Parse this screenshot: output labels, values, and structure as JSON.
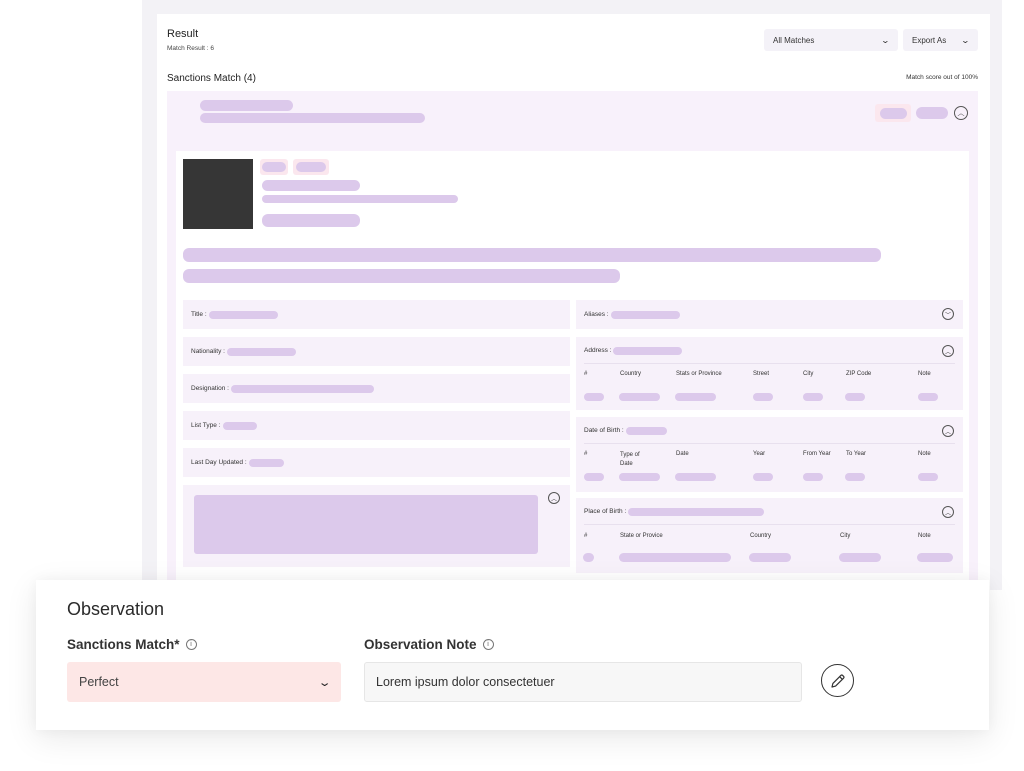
{
  "result": {
    "title": "Result",
    "subtitle": "Match Result : 6",
    "filter": {
      "label": "All Matches",
      "icon": "chevron-down-icon"
    },
    "export": {
      "label": "Export As",
      "icon": "chevron-down-icon"
    },
    "heading": "Sanctions Match (4)",
    "score_label": "Match score out of 100%"
  },
  "details": {
    "left_fields": {
      "title": "Title :",
      "nationality": "Nationality :",
      "designation": "Designation :",
      "list_type": "List Type :",
      "last_day_updated": "Last Day Updated :"
    },
    "aliases": {
      "label": "Aliases :",
      "icon": "chevron-down-circle-icon"
    },
    "address": {
      "label": "Address :",
      "icon": "chevron-up-circle-icon",
      "columns": [
        "#",
        "Country",
        "Stats or Province",
        "Street",
        "City",
        "ZIP Code",
        "Note"
      ]
    },
    "date_of_birth": {
      "label": "Date of Birth :",
      "icon": "chevron-up-circle-icon",
      "columns": [
        "#",
        "Type of Date",
        "Date",
        "Year",
        "From Year",
        "To Year",
        "Note"
      ]
    },
    "place_of_birth": {
      "label": "Place of Birth :",
      "icon": "chevron-up-circle-icon",
      "columns": [
        "#",
        "State or Provice",
        "Country",
        "City",
        "Note"
      ]
    }
  },
  "observation": {
    "title": "Observation",
    "sanctions_match_label": "Sanctions Match*",
    "sanctions_match_value": "Perfect",
    "note_label": "Observation Note",
    "note_value": "Lorem ipsum dolor consectetuer",
    "info_icon": "info-icon",
    "edit_icon": "pencil-icon"
  },
  "colors": {
    "placeholder": "#dcc9eb",
    "band": "#f8f1fb",
    "select_bg": "#fde7e6"
  }
}
